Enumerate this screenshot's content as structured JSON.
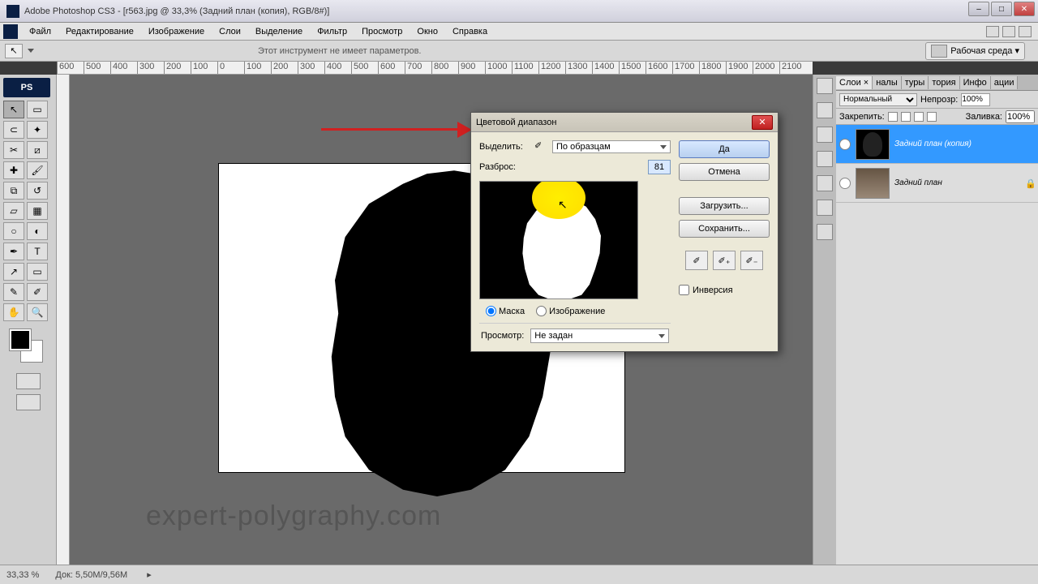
{
  "titlebar": {
    "title": "Adobe Photoshop CS3 - [r563.jpg @ 33,3% (Задний план (копия), RGB/8#)]"
  },
  "menu": {
    "file": "Файл",
    "edit": "Редактирование",
    "image": "Изображение",
    "layer": "Слои",
    "select": "Выделение",
    "filter": "Фильтр",
    "view": "Просмотр",
    "window": "Окно",
    "help": "Справка"
  },
  "optionsbar": {
    "info": "Этот инструмент не имеет параметров.",
    "workspace": "Рабочая среда ▾"
  },
  "ruler": {
    "marks": [
      "600",
      "500",
      "400",
      "300",
      "200",
      "100",
      "0",
      "100",
      "200",
      "300",
      "400",
      "500",
      "600",
      "700",
      "800",
      "900",
      "1000",
      "1100",
      "1200",
      "1300",
      "1400",
      "1500",
      "1600",
      "1700",
      "1800",
      "1900",
      "2000",
      "2100"
    ]
  },
  "toolbar": {
    "head": "PS"
  },
  "dialog": {
    "title": "Цветовой диапазон",
    "select_label": "Выделить:",
    "select_value": "По образцам",
    "fuzziness_label": "Разброс:",
    "fuzziness_value": "81",
    "radio_mask": "Маска",
    "radio_image": "Изображение",
    "preview_label": "Просмотр:",
    "preview_value": "Не задан",
    "ok": "Да",
    "cancel": "Отмена",
    "load": "Загрузить...",
    "save": "Сохранить...",
    "invert": "Инверсия"
  },
  "panels": {
    "tabs": {
      "layers": "Слои ×",
      "channels": "налы",
      "paths": "туры",
      "history": "тория",
      "info": "Инфо",
      "actions": "ации"
    },
    "blend_mode": "Нормальный",
    "opacity_label": "Непрозр:",
    "opacity_value": "100%",
    "lock_label": "Закрепить:",
    "fill_label": "Заливка:",
    "fill_value": "100%",
    "layer1": "Задний план (копия)",
    "layer2": "Задний план"
  },
  "statusbar": {
    "zoom": "33,33 %",
    "docsize": "Док: 5,50M/9,56M"
  },
  "watermark": "expert-polygraphy.com"
}
